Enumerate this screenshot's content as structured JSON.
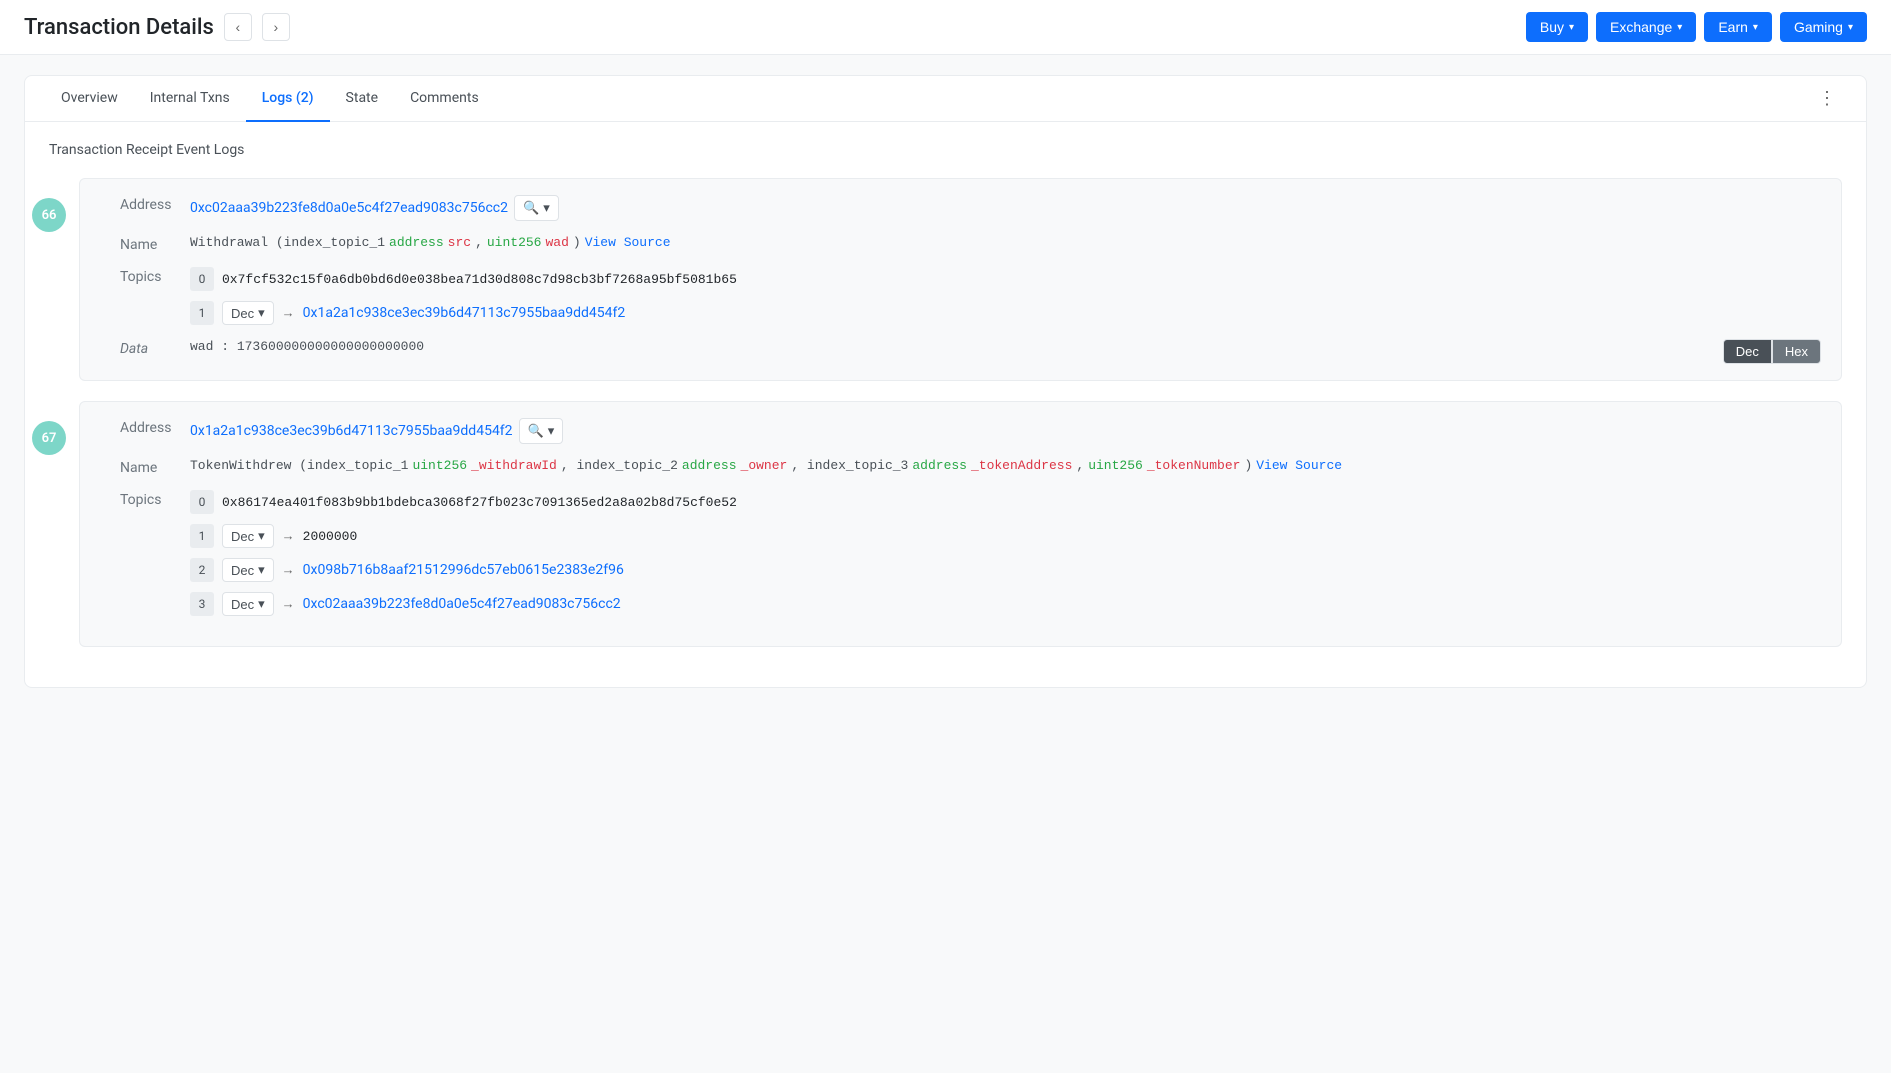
{
  "header": {
    "title": "Transaction Details",
    "nav_prev": "‹",
    "nav_next": "›",
    "buttons": [
      {
        "label": "Buy",
        "id": "buy"
      },
      {
        "label": "Exchange",
        "id": "exchange"
      },
      {
        "label": "Earn",
        "id": "earn"
      },
      {
        "label": "Gaming",
        "id": "gaming"
      }
    ]
  },
  "tabs": [
    {
      "label": "Overview",
      "active": false
    },
    {
      "label": "Internal Txns",
      "active": false
    },
    {
      "label": "Logs (2)",
      "active": true
    },
    {
      "label": "State",
      "active": false
    },
    {
      "label": "Comments",
      "active": false
    }
  ],
  "section_title": "Transaction Receipt Event Logs",
  "logs": [
    {
      "number": "66",
      "address_label": "Address",
      "address": "0xc02aaa39b223fe8d0a0e5c4f27ead9083c756cc2",
      "name_label": "Name",
      "name_prefix": "Withdrawal (index_topic_1",
      "name_param1_type": "address",
      "name_param1_name": "src",
      "name_sep": ",",
      "name_param2_type": "uint256",
      "name_param2_name": "wad",
      "name_suffix": ") View Source",
      "topics_label": "Topics",
      "topics": [
        {
          "index": "0",
          "value": "0x7fcf532c15f0a6db0bd6d0e038bea71d30d808c7d98cb3bf7268a95bf5081b65",
          "is_hash": true
        },
        {
          "index": "1",
          "dec_btn": "Dec",
          "arrow": "→",
          "value": "0x1a2a1c938ce3ec39b6d47113c7955baa9dd454f2",
          "is_link": true
        }
      ],
      "data_label": "Data",
      "data_key": "wad",
      "data_value": "173600000000000000000000",
      "data_btn1": "Dec",
      "data_btn2": "Hex"
    },
    {
      "number": "67",
      "address_label": "Address",
      "address": "0x1a2a1c938ce3ec39b6d47113c7955baa9dd454f2",
      "name_label": "Name",
      "name_prefix": "TokenWithdrew (index_topic_1",
      "name_param1_type": "uint256",
      "name_param1_name": "_withdrawId",
      "name_sep1": ", index_topic_2",
      "name_param2_type": "address",
      "name_param2_name": "_owner",
      "name_sep2": ", index_topic_3",
      "name_param3_type": "address",
      "name_param3_name": "_tokenAddress",
      "name_sep3": ",",
      "name_param4_type": "uint256",
      "name_param4_name": "_tokenNumber",
      "name_suffix": ") View Source",
      "topics_label": "Topics",
      "topics": [
        {
          "index": "0",
          "value": "0x86174ea401f083b9bb1bdebca3068f27fb023c7091365ed2a8a02b8d75cf0e52",
          "is_hash": true
        },
        {
          "index": "1",
          "dec_btn": "Dec",
          "arrow": "→",
          "value": "2000000",
          "is_link": false
        },
        {
          "index": "2",
          "dec_btn": "Dec",
          "arrow": "→",
          "value": "0x098b716b8aaf21512996dc57eb0615e2383e2f96",
          "is_link": true
        },
        {
          "index": "3",
          "dec_btn": "Dec",
          "arrow": "→",
          "value": "0xc02aaa39b223fe8d0a0e5c4f27ead9083c756cc2",
          "is_link": true
        }
      ]
    }
  ]
}
